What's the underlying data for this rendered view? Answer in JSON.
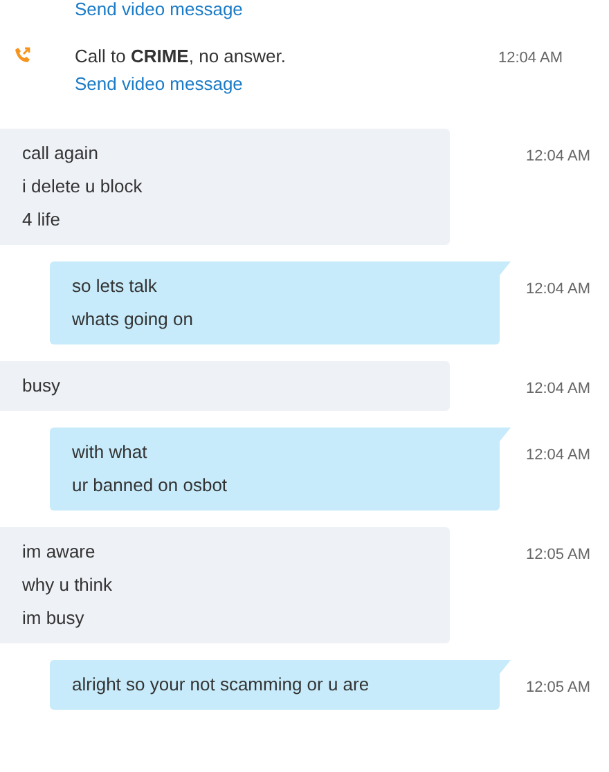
{
  "events": [
    {
      "kind": "link",
      "link": "Send video message"
    },
    {
      "kind": "call",
      "text": "Call to **CRIME**, no answer.",
      "time": "12:04 AM",
      "link": "Send video message"
    },
    {
      "kind": "message",
      "outgoing": false,
      "lines": [
        "call again",
        "i delete u block",
        "4 life"
      ],
      "time": "12:04 AM"
    },
    {
      "kind": "message",
      "outgoing": true,
      "lines": [
        "so lets talk",
        "whats going on"
      ],
      "time": "12:04 AM"
    },
    {
      "kind": "message",
      "outgoing": false,
      "lines": [
        "busy"
      ],
      "time": "12:04 AM"
    },
    {
      "kind": "message",
      "outgoing": true,
      "lines": [
        "with what",
        "ur banned on osbot"
      ],
      "time": "12:04 AM"
    },
    {
      "kind": "message",
      "outgoing": false,
      "lines": [
        "im aware",
        "why u think",
        "im busy"
      ],
      "time": "12:05 AM"
    },
    {
      "kind": "message",
      "outgoing": true,
      "lines": [
        "alright so your not scamming or u are"
      ],
      "time": "12:05 AM"
    }
  ]
}
